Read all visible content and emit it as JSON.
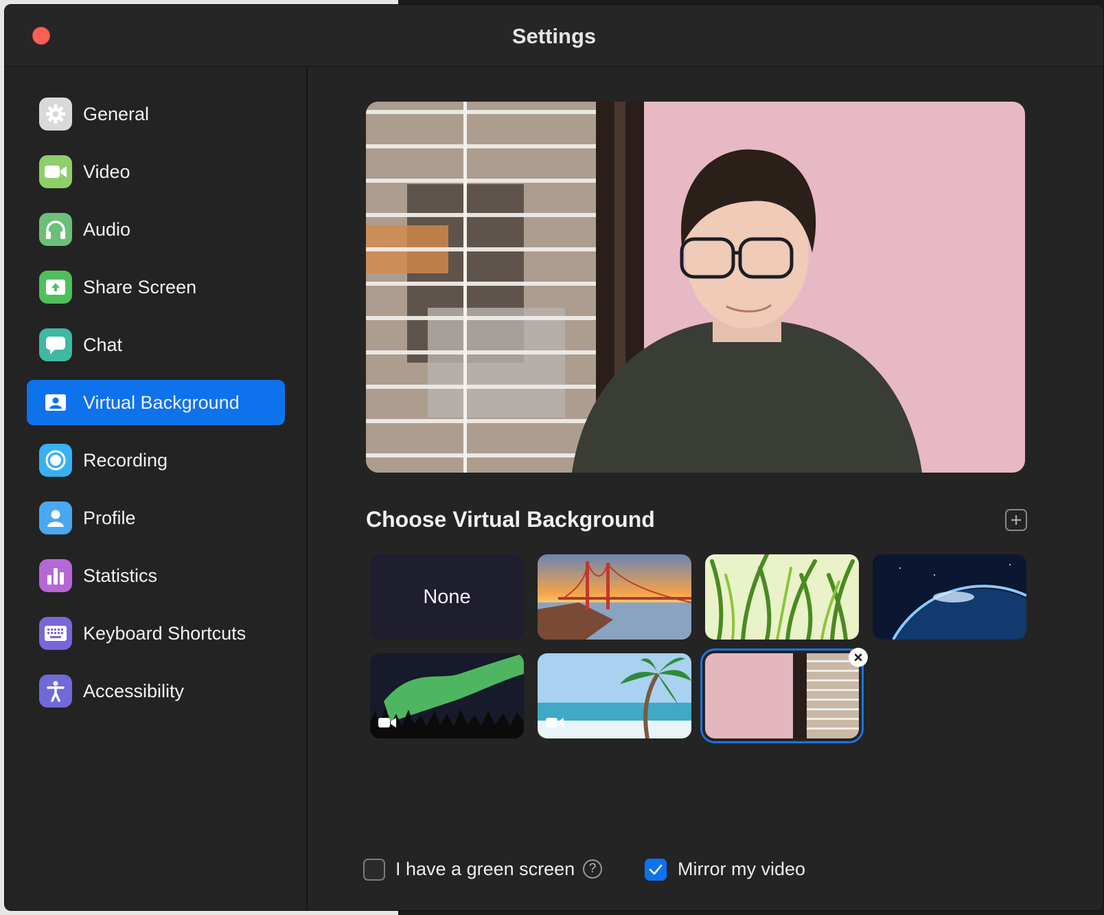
{
  "window": {
    "title": "Settings"
  },
  "sidebar": {
    "items": [
      {
        "label": "General",
        "icon": "gear-icon",
        "color": "#d9d9d9",
        "active": false
      },
      {
        "label": "Video",
        "icon": "video-camera-icon",
        "color": "#8fcf6a",
        "active": false
      },
      {
        "label": "Audio",
        "icon": "headphones-icon",
        "color": "#6cbf7a",
        "active": false
      },
      {
        "label": "Share Screen",
        "icon": "share-screen-icon",
        "color": "#4fbf5c",
        "active": false
      },
      {
        "label": "Chat",
        "icon": "chat-bubble-icon",
        "color": "#3fb8a4",
        "active": false
      },
      {
        "label": "Virtual Background",
        "icon": "virtual-background-icon",
        "color": "#0e72ed",
        "active": true
      },
      {
        "label": "Recording",
        "icon": "record-icon",
        "color": "#39b0f0",
        "active": false
      },
      {
        "label": "Profile",
        "icon": "person-icon",
        "color": "#4aa7f0",
        "active": false
      },
      {
        "label": "Statistics",
        "icon": "bar-chart-icon",
        "color": "#b667d6",
        "active": false
      },
      {
        "label": "Keyboard Shortcuts",
        "icon": "keyboard-icon",
        "color": "#7a66d9",
        "active": false
      },
      {
        "label": "Accessibility",
        "icon": "accessibility-icon",
        "color": "#6f6ad8",
        "active": false
      }
    ]
  },
  "content": {
    "section_title": "Choose Virtual Background",
    "backgrounds": [
      {
        "label": "None",
        "kind": "none"
      },
      {
        "label": "",
        "kind": "golden-gate"
      },
      {
        "label": "",
        "kind": "grass"
      },
      {
        "label": "",
        "kind": "earth-space"
      },
      {
        "label": "",
        "kind": "aurora",
        "video": true
      },
      {
        "label": "",
        "kind": "beach",
        "video": true
      },
      {
        "label": "",
        "kind": "custom-room",
        "selected": true,
        "removable": true
      }
    ],
    "green_screen_label": "I have a green screen",
    "green_screen_checked": false,
    "mirror_label": "Mirror my video",
    "mirror_checked": true
  },
  "colors": {
    "accent": "#0e72ed",
    "close": "#fe5f57"
  }
}
